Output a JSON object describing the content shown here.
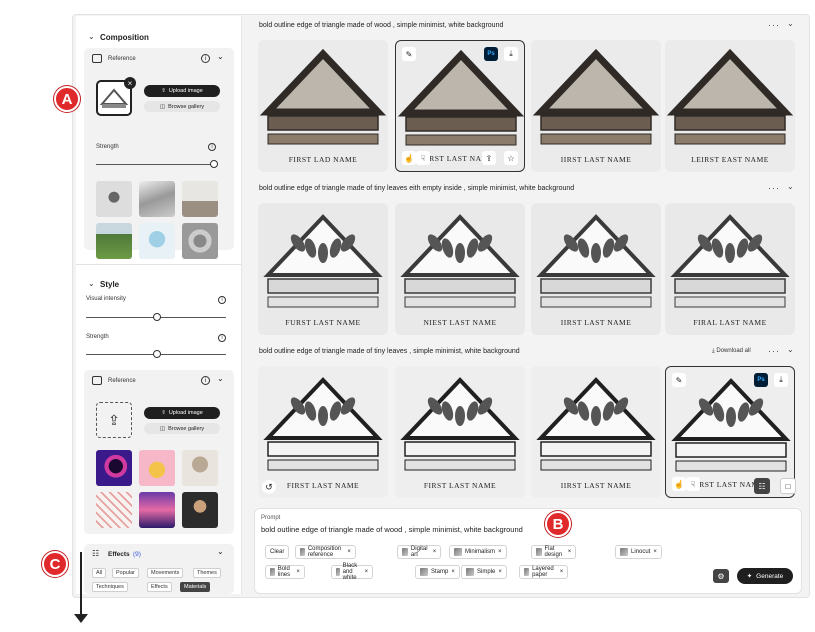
{
  "panel": {
    "composition": {
      "title": "Composition",
      "reference_label": "Reference",
      "upload_label": "Upload image",
      "browse_label": "Browse gallery",
      "strength_label": "Strength",
      "strength": 0.98
    },
    "style": {
      "title": "Style",
      "visual_intensity_label": "Visual intensity",
      "visual_intensity": 0.5,
      "strength_label": "Strength",
      "strength": 0.5,
      "reference_label": "Reference",
      "upload_label": "Upload image",
      "browse_label": "Browse gallery"
    },
    "effects": {
      "title": "Effects",
      "count": "(9)",
      "tabs": [
        "All",
        "Popular",
        "Movements",
        "Themes",
        "Techniques",
        "Effects",
        "Materials"
      ],
      "active_tab": "Materials"
    }
  },
  "rows": [
    {
      "prompt": "bold outline edge of triangle made of wood , simple minimist, white background",
      "captions": [
        "FIRST LAD NAME",
        "IRST LAST NAME",
        "IIRST LAST NAME",
        "LEIRST EAST NAME"
      ]
    },
    {
      "prompt": "bold outline edge of triangle made of tiny leaves eith empty inside , simple minimist, white background",
      "captions": [
        "FURST LAST NAME",
        "NIEST LAST NAME",
        "IIRST LAST NAME",
        "FIRAL LAST NAME"
      ]
    },
    {
      "prompt": "bold outline edge of triangle made of tiny leaves , simple minimist, white background",
      "captions": [
        "FIRST LAST NAME",
        "FIRST LAST NAME",
        "IIRST LAST NAME",
        "IRST LAST NAME"
      ],
      "download_all": "Download all"
    }
  ],
  "prompt_box": {
    "label": "Prompt",
    "text": "bold outline edge of triangle made of wood , simple minimist, white background",
    "clear": "Clear",
    "chips": [
      "Composition reference",
      "Digital art",
      "Minimalism",
      "Flat design",
      "Linocut",
      "Bold lines",
      "Black and white",
      "Stamp",
      "Simple",
      "Layered paper"
    ],
    "generate": "Generate"
  },
  "badges": [
    "A",
    "B",
    "C"
  ],
  "ps_badge": "Ps"
}
